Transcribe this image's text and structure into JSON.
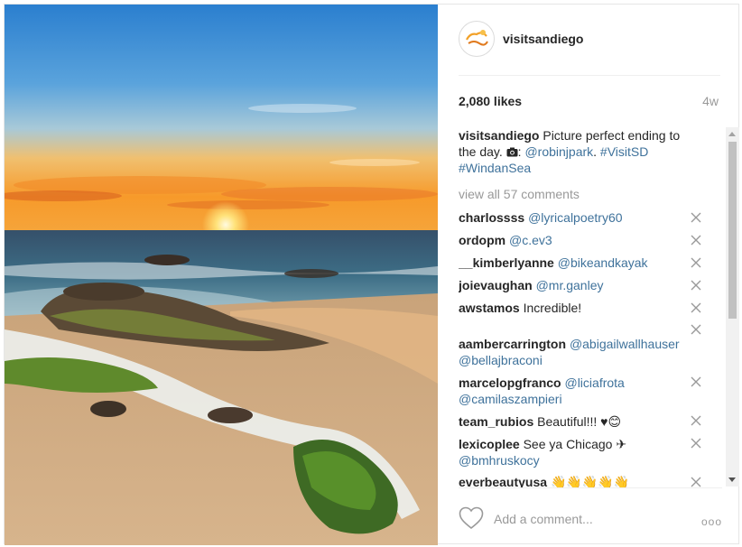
{
  "post": {
    "username": "visitsandiego",
    "likes": "2,080 likes",
    "age": "4w",
    "caption": {
      "user": "visitsandiego",
      "text_before": " Picture perfect ending to the day. ",
      "camera_icon": "camera-icon",
      "text_colon": ": ",
      "mention": "@robinjpark",
      "text_dot": ". ",
      "tag1": "#VisitSD",
      "tag2": "#WindanSea"
    },
    "view_all": "view all 57 comments",
    "comments": [
      {
        "user": "charlossss",
        "mention": "@lyricalpoetry60",
        "text": ""
      },
      {
        "user": "ordopm",
        "mention": "@c.ev3",
        "text": ""
      },
      {
        "user": "__kimberlyanne",
        "mention": "@bikeandkayak",
        "text": ""
      },
      {
        "user": "joievaughan",
        "mention": "@mr.ganley",
        "text": ""
      },
      {
        "user": "awstamos",
        "mention": "",
        "text": "Incredible!"
      },
      {
        "user": "aambercarrington",
        "mention": "@abigailwallhauser",
        "mention2": "@bellajbraconi",
        "text": ""
      },
      {
        "user": "marcelopgfranco",
        "mention": "@liciafrota",
        "mention2": "@camilaszampieri",
        "text": ""
      },
      {
        "user": "team_rubios",
        "mention": "",
        "text": "Beautiful!!! ♥😊"
      },
      {
        "user": "lexicoplee",
        "mention": "",
        "text": "See ya Chicago ✈",
        "mention2": "@bmhruskocy"
      },
      {
        "user": "everbeautyusa",
        "mention": "",
        "text": "👋👋👋👋👋"
      }
    ],
    "add_comment_placeholder": "Add a comment...",
    "more_options": "ooo"
  },
  "colors": {
    "link": "#3f729b",
    "muted": "#999999",
    "text": "#262626"
  },
  "icons": [
    "avatar-logo",
    "camera-icon",
    "close-icon",
    "heart-icon",
    "more-options-icon"
  ]
}
